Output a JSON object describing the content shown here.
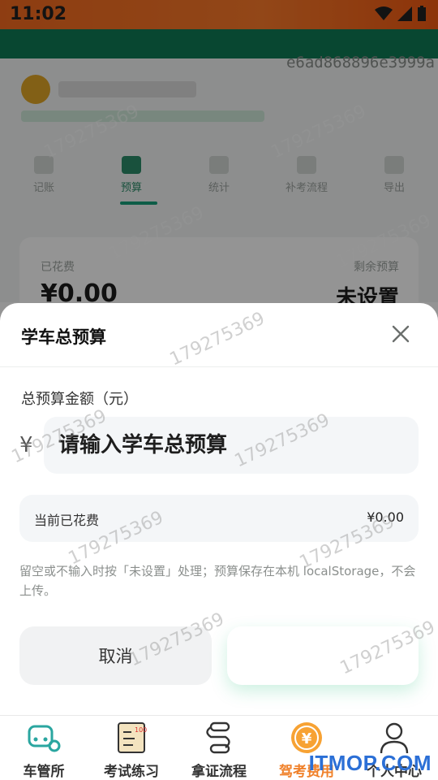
{
  "status_bar": {
    "time": "11:02"
  },
  "watermark_top": "e6ad868896e3999a",
  "background": {
    "tabs": [
      {
        "label": "记账"
      },
      {
        "label": "预算"
      },
      {
        "label": "统计"
      },
      {
        "label": "补考流程"
      },
      {
        "label": "导出"
      }
    ],
    "card": {
      "spent_label": "已花费",
      "remaining_label": "剩余预算",
      "spent_value": "¥0.00",
      "remaining_value": "未设置"
    }
  },
  "sheet": {
    "title": "学车总预算",
    "field_label": "总预算金额（元）",
    "currency_symbol": "¥",
    "input_placeholder": "请输入学车总预算",
    "spent_label": "当前已花费",
    "spent_value": "¥0.00",
    "hint": "留空或不输入时按「未设置」处理；预算保存在本机 localStorage，不会上传。",
    "cancel_label": "取消",
    "confirm_label": ""
  },
  "watermark": "179275369",
  "bottom_nav": {
    "items": [
      {
        "label": "车管所",
        "icon": "car-gear-icon"
      },
      {
        "label": "考试练习",
        "icon": "notebook-icon"
      },
      {
        "label": "拿证流程",
        "icon": "flow-icon"
      },
      {
        "label": "驾考费用",
        "icon": "yen-coin-icon"
      },
      {
        "label": "个人中心",
        "icon": "person-icon"
      }
    ]
  },
  "brand": "ITMOP.COM",
  "colors": {
    "accent": "#f0812a",
    "teal": "#0f7a55",
    "green": "#17a07a"
  }
}
